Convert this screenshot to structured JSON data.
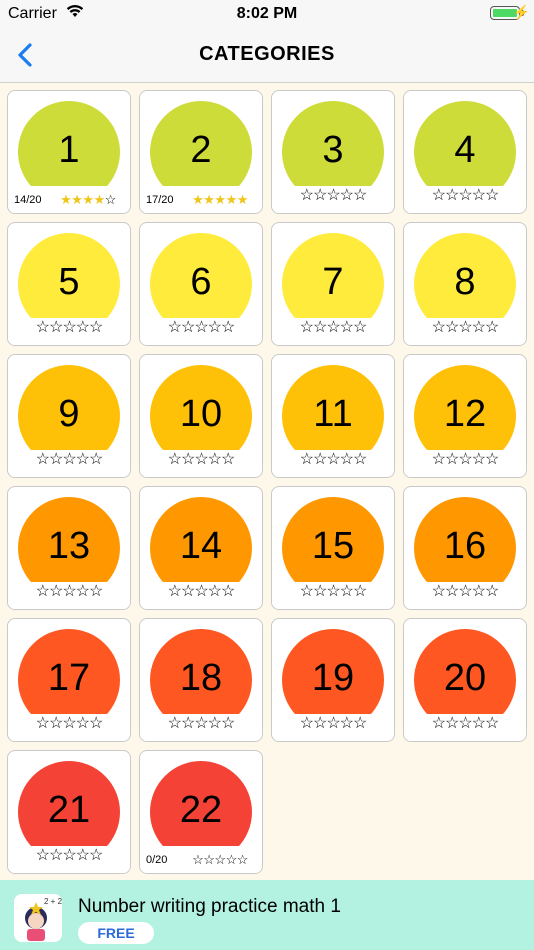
{
  "status": {
    "carrier": "Carrier",
    "time": "8:02 PM"
  },
  "nav": {
    "title": "CATEGORIES"
  },
  "categories": [
    {
      "label": "1",
      "color": "#cddc39",
      "stars": "☆☆☆☆☆",
      "filled": 4,
      "score": "14/20"
    },
    {
      "label": "2",
      "color": "#cddc39",
      "stars": "☆☆☆☆☆",
      "filled": 5,
      "score": "17/20"
    },
    {
      "label": "3",
      "color": "#cddc39",
      "stars": "☆☆☆☆☆",
      "filled": 0,
      "score": ""
    },
    {
      "label": "4",
      "color": "#cddc39",
      "stars": "☆☆☆☆☆",
      "filled": 0,
      "score": ""
    },
    {
      "label": "5",
      "color": "#ffeb3b",
      "stars": "☆☆☆☆☆",
      "filled": 0,
      "score": ""
    },
    {
      "label": "6",
      "color": "#ffeb3b",
      "stars": "☆☆☆☆☆",
      "filled": 0,
      "score": ""
    },
    {
      "label": "7",
      "color": "#ffeb3b",
      "stars": "☆☆☆☆☆",
      "filled": 0,
      "score": ""
    },
    {
      "label": "8",
      "color": "#ffeb3b",
      "stars": "☆☆☆☆☆",
      "filled": 0,
      "score": ""
    },
    {
      "label": "9",
      "color": "#ffc107",
      "stars": "☆☆☆☆☆",
      "filled": 0,
      "score": ""
    },
    {
      "label": "10",
      "color": "#ffc107",
      "stars": "☆☆☆☆☆",
      "filled": 0,
      "score": ""
    },
    {
      "label": "11",
      "color": "#ffc107",
      "stars": "☆☆☆☆☆",
      "filled": 0,
      "score": ""
    },
    {
      "label": "12",
      "color": "#ffc107",
      "stars": "☆☆☆☆☆",
      "filled": 0,
      "score": ""
    },
    {
      "label": "13",
      "color": "#ff9800",
      "stars": "☆☆☆☆☆",
      "filled": 0,
      "score": ""
    },
    {
      "label": "14",
      "color": "#ff9800",
      "stars": "☆☆☆☆☆",
      "filled": 0,
      "score": ""
    },
    {
      "label": "15",
      "color": "#ff9800",
      "stars": "☆☆☆☆☆",
      "filled": 0,
      "score": ""
    },
    {
      "label": "16",
      "color": "#ff9800",
      "stars": "☆☆☆☆☆",
      "filled": 0,
      "score": ""
    },
    {
      "label": "17",
      "color": "#ff5722",
      "stars": "☆☆☆☆☆",
      "filled": 0,
      "score": ""
    },
    {
      "label": "18",
      "color": "#ff5722",
      "stars": "☆☆☆☆☆",
      "filled": 0,
      "score": ""
    },
    {
      "label": "19",
      "color": "#ff5722",
      "stars": "☆☆☆☆☆",
      "filled": 0,
      "score": ""
    },
    {
      "label": "20",
      "color": "#ff5722",
      "stars": "☆☆☆☆☆",
      "filled": 0,
      "score": ""
    },
    {
      "label": "21",
      "color": "#f44336",
      "stars": "☆☆☆☆☆",
      "filled": 0,
      "score": ""
    },
    {
      "label": "22",
      "color": "#f44336",
      "stars": "☆☆☆☆☆",
      "filled": 0,
      "score": "0/20"
    }
  ],
  "ad": {
    "title": "Number writing practice math 1",
    "button": "FREE",
    "icon_text": "2 + 2"
  }
}
